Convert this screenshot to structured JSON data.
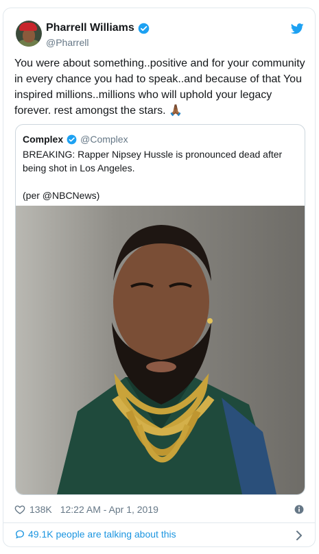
{
  "author": {
    "name": "Pharrell Williams",
    "handle": "@Pharrell"
  },
  "tweet_text": "You were about something..positive and for your community in every chance you had to speak..and because of that You inspired millions..millions who will uphold your legacy forever. rest amongst the stars. 🙏🏾",
  "quoted": {
    "name": "Complex",
    "handle": "@Complex",
    "line1": "BREAKING: Rapper Nipsey Hussle is pronounced dead after being shot in Los Angeles.",
    "line2": "(per @NBCNews)"
  },
  "footer": {
    "likes": "138K",
    "timestamp": "12:22 AM - Apr 1, 2019"
  },
  "talking": "49.1K people are talking about this",
  "colors": {
    "twitter_blue": "#1da1f2",
    "link_blue": "#1b95e0",
    "muted": "#657786"
  },
  "icons": [
    "verified-icon",
    "twitter-bird-icon",
    "heart-icon",
    "info-icon",
    "comment-bubble-icon",
    "chevron-right-icon"
  ]
}
